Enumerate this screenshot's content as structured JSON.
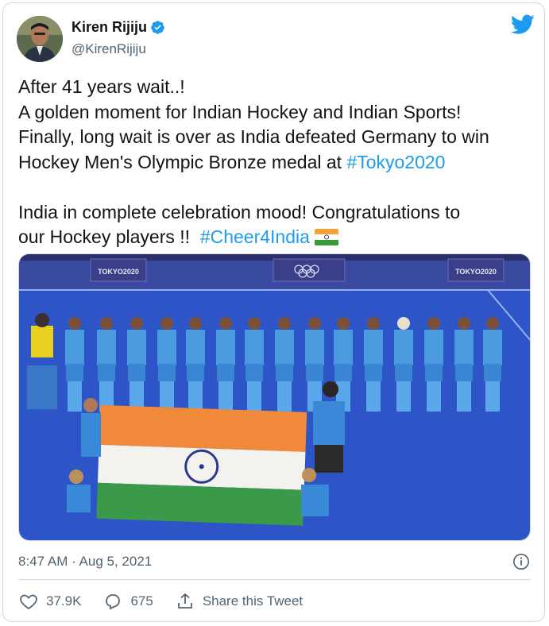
{
  "author": {
    "name": "Kiren Rijiju",
    "handle": "@KirenRijiju",
    "verified_icon": "verified-badge-icon",
    "avatar_icon": "profile-avatar"
  },
  "tweet": {
    "line1": "After 41 years wait..!",
    "line2": "A golden moment for Indian Hockey and Indian Sports!",
    "line3": "Finally, long wait is over as India defeated Germany to win",
    "line4_prefix": "Hockey Men's Olympic Bronze medal at ",
    "line4_hashtag": "#Tokyo2020",
    "line5": "India in complete celebration mood! Congratulations to",
    "line6_prefix": "our Hockey players !!  ",
    "line6_hashtag": "#Cheer4India",
    "flag_emoji": "india-flag-emoji"
  },
  "photo": {
    "banner_left": "TOKYO2020",
    "banner_right": "TOKYO2020",
    "description_icon": "team-photo"
  },
  "meta": {
    "timestamp": "8:47 AM · Aug 5, 2021"
  },
  "actions": {
    "likes": "37.9K",
    "replies": "675",
    "share_label": "Share this Tweet"
  },
  "colors": {
    "accent": "#1d9bf0",
    "text_secondary": "#536471",
    "border": "#cfd9de"
  }
}
